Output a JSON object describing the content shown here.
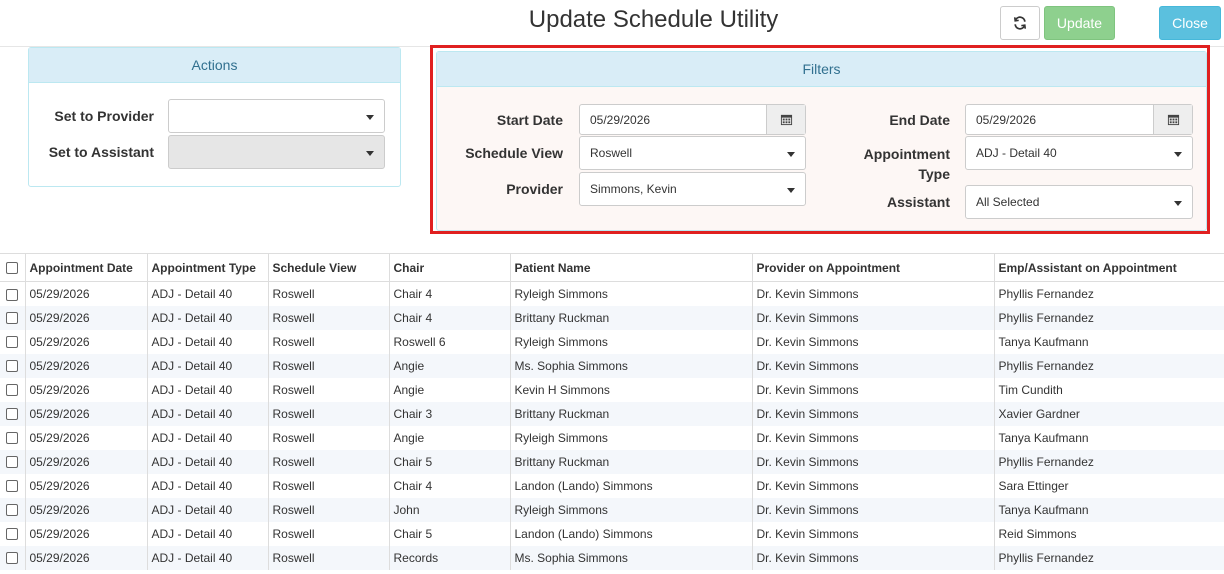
{
  "header": {
    "title": "Update Schedule Utility",
    "update_label": "Update",
    "close_label": "Close"
  },
  "actions": {
    "heading": "Actions",
    "set_provider_label": "Set to Provider",
    "set_provider_value": "",
    "set_assistant_label": "Set to Assistant",
    "set_assistant_value": ""
  },
  "filters": {
    "heading": "Filters",
    "start_date_label": "Start Date",
    "start_date_value": "05/29/2026",
    "end_date_label": "End Date",
    "end_date_value": "05/29/2026",
    "schedule_view_label": "Schedule View",
    "schedule_view_value": "Roswell",
    "appointment_type_label_1": "Appointment",
    "appointment_type_label_2": "Type",
    "appointment_type_value": "ADJ - Detail 40",
    "provider_label": "Provider",
    "provider_value": "Simmons, Kevin",
    "assistant_label": "Assistant",
    "assistant_value": "All Selected"
  },
  "table": {
    "columns": [
      "Appointment Date",
      "Appointment Type",
      "Schedule View",
      "Chair",
      "Patient Name",
      "Provider on Appointment",
      "Emp/Assistant on Appointment"
    ],
    "rows": [
      [
        "05/29/2026",
        "ADJ - Detail 40",
        "Roswell",
        "Chair 4",
        "Ryleigh Simmons",
        "Dr. Kevin Simmons",
        "Phyllis Fernandez"
      ],
      [
        "05/29/2026",
        "ADJ - Detail 40",
        "Roswell",
        "Chair 4",
        "Brittany Ruckman",
        "Dr. Kevin Simmons",
        "Phyllis Fernandez"
      ],
      [
        "05/29/2026",
        "ADJ - Detail 40",
        "Roswell",
        "Roswell 6",
        "Ryleigh Simmons",
        "Dr. Kevin Simmons",
        "Tanya Kaufmann"
      ],
      [
        "05/29/2026",
        "ADJ - Detail 40",
        "Roswell",
        "Angie",
        "Ms. Sophia Simmons",
        "Dr. Kevin Simmons",
        "Phyllis Fernandez"
      ],
      [
        "05/29/2026",
        "ADJ - Detail 40",
        "Roswell",
        "Angie",
        "Kevin H Simmons",
        "Dr. Kevin Simmons",
        "Tim Cundith"
      ],
      [
        "05/29/2026",
        "ADJ - Detail 40",
        "Roswell",
        "Chair 3",
        "Brittany Ruckman",
        "Dr. Kevin Simmons",
        "Xavier Gardner"
      ],
      [
        "05/29/2026",
        "ADJ - Detail 40",
        "Roswell",
        "Angie",
        "Ryleigh Simmons",
        "Dr. Kevin Simmons",
        "Tanya Kaufmann"
      ],
      [
        "05/29/2026",
        "ADJ - Detail 40",
        "Roswell",
        "Chair 5",
        "Brittany Ruckman",
        "Dr. Kevin Simmons",
        "Phyllis Fernandez"
      ],
      [
        "05/29/2026",
        "ADJ - Detail 40",
        "Roswell",
        "Chair 4",
        "Landon (Lando) Simmons",
        "Dr. Kevin Simmons",
        "Sara Ettinger"
      ],
      [
        "05/29/2026",
        "ADJ - Detail 40",
        "Roswell",
        "John",
        "Ryleigh Simmons",
        "Dr. Kevin Simmons",
        "Tanya Kaufmann"
      ],
      [
        "05/29/2026",
        "ADJ - Detail 40",
        "Roswell",
        "Chair 5",
        "Landon (Lando) Simmons",
        "Dr. Kevin Simmons",
        "Reid Simmons"
      ],
      [
        "05/29/2026",
        "ADJ - Detail 40",
        "Roswell",
        "Records",
        "Ms. Sophia Simmons",
        "Dr. Kevin Simmons",
        "Phyllis Fernandez"
      ]
    ]
  },
  "icons": {
    "refresh": "refresh-icon",
    "calendar": "calendar-icon",
    "dropdown": "chevron-down-icon"
  },
  "colors": {
    "update_button": "#8ed08e",
    "close_button": "#5bc0de",
    "panel_heading": "#d9edf7",
    "filter_highlight": "#e02020"
  }
}
